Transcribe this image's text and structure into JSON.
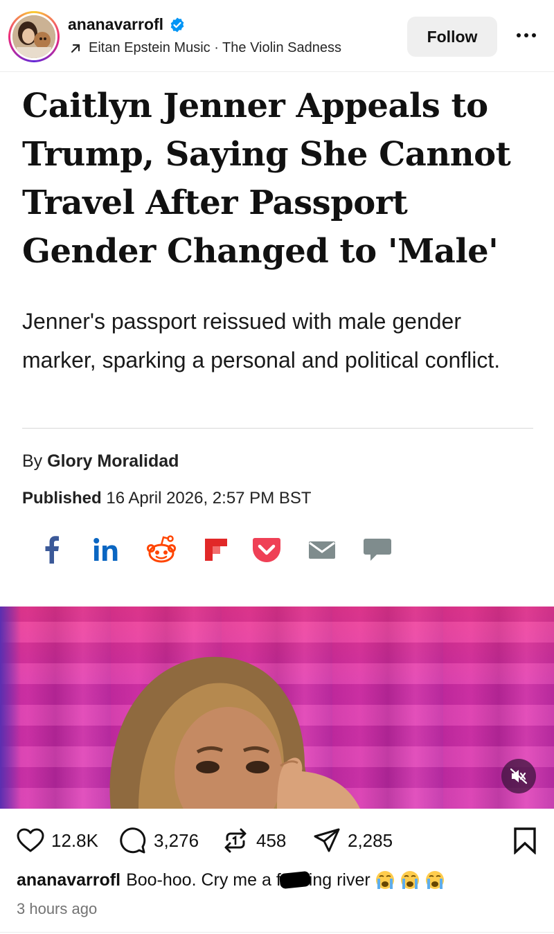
{
  "post": {
    "username": "ananavarrofl",
    "audio_label": "Eitan Epstein Music · The Violin Sadness",
    "follow_label": "Follow"
  },
  "article": {
    "headline_lines": [
      "Caitlyn Jenner Appeals to",
      "Trump, Saying She Cannot",
      "Travel After Passport",
      "Gender Changed to 'Male'"
    ],
    "dek": "Jenner's passport reissued with male gender marker, sparking a personal and political conflict.",
    "byline_prefix": "By",
    "author": "Glory Moralidad",
    "published_label": "Published",
    "published_date": "16 April 2026, 2:57 PM BST",
    "share_icons": [
      "facebook-icon",
      "linkedin-icon",
      "reddit-icon",
      "flipboard-icon",
      "pocket-icon",
      "email-icon",
      "comment-icon"
    ]
  },
  "metrics": {
    "likes": "12.8K",
    "comments": "3,276",
    "reposts": "458",
    "shares": "2,285"
  },
  "caption": {
    "username": "ananavarrofl",
    "text_before": "Boo-hoo. Cry me a f",
    "text_after": "ing river"
  },
  "timestamp": "3 hours ago",
  "colors": {
    "facebook": "#3b5998",
    "linkedin": "#0a66c2",
    "reddit": "#ff4500",
    "flipboard": "#e12828",
    "pocket": "#ef4056",
    "email": "#7f8c8d",
    "comment": "#7f8c8d",
    "verified": "#0095f6",
    "follow_bg": "#efefef"
  }
}
